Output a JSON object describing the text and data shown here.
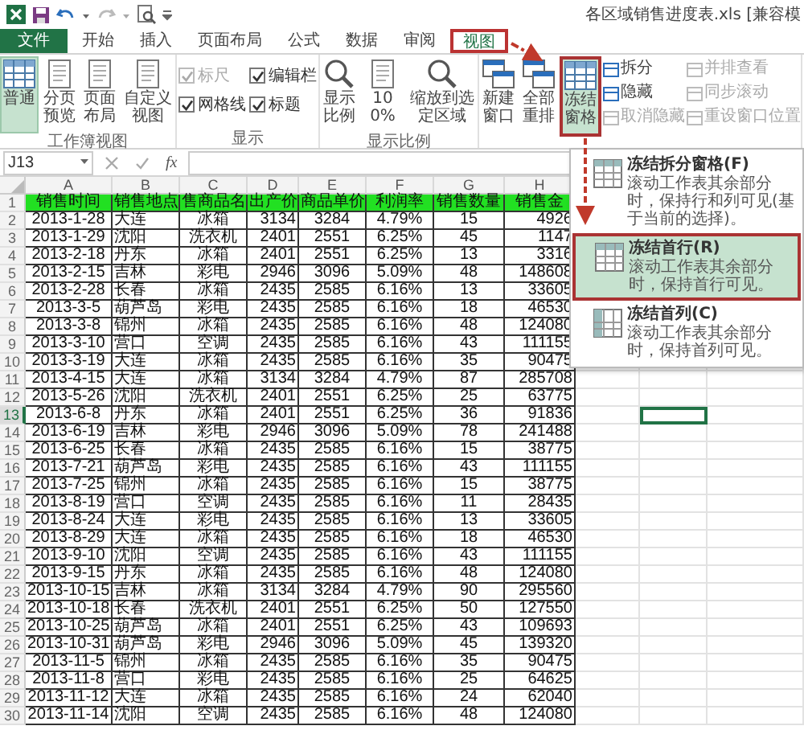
{
  "title_bar": {
    "title": "各区域销售进度表.xls  [兼容模"
  },
  "tabs": [
    {
      "label": "文件",
      "kind": "file",
      "selected": false,
      "highlighted": false
    },
    {
      "label": "开始",
      "kind": "tab",
      "selected": false,
      "highlighted": false
    },
    {
      "label": "插入",
      "kind": "tab",
      "selected": false,
      "highlighted": false
    },
    {
      "label": "页面布局",
      "kind": "tab",
      "selected": false,
      "highlighted": false
    },
    {
      "label": "公式",
      "kind": "tab",
      "selected": false,
      "highlighted": false
    },
    {
      "label": "数据",
      "kind": "tab",
      "selected": false,
      "highlighted": false
    },
    {
      "label": "审阅",
      "kind": "tab",
      "selected": false,
      "highlighted": false
    },
    {
      "label": "视图",
      "kind": "tab",
      "selected": true,
      "highlighted": true
    }
  ],
  "ribbon": {
    "groups": [
      {
        "label": "工作簿视图",
        "items": [
          {
            "kind": "large",
            "label": "普通",
            "selected": true,
            "highlighted": false
          },
          {
            "kind": "large",
            "label": "分页预览",
            "selected": false,
            "highlighted": false
          },
          {
            "kind": "large",
            "label": "页面布局",
            "selected": false,
            "highlighted": false
          },
          {
            "kind": "large",
            "label": "自定义视图",
            "selected": false,
            "highlighted": false
          }
        ]
      },
      {
        "label": "显示",
        "items": [
          {
            "kind": "check",
            "label": "标尺",
            "checked": true,
            "disabled": true
          },
          {
            "kind": "check",
            "label": "网格线",
            "checked": true,
            "disabled": false
          },
          {
            "kind": "check",
            "label": "编辑栏",
            "checked": true,
            "disabled": false
          },
          {
            "kind": "check",
            "label": "标题",
            "checked": true,
            "disabled": false
          }
        ]
      },
      {
        "label": "显示比例",
        "items": [
          {
            "kind": "large",
            "label": "显示比例",
            "selected": false,
            "highlighted": false
          },
          {
            "kind": "large",
            "label": "100%",
            "selected": false,
            "highlighted": false
          },
          {
            "kind": "large",
            "label": "缩放到选定区域",
            "selected": false,
            "highlighted": false
          }
        ]
      },
      {
        "items": [
          {
            "kind": "large",
            "label": "新建窗口",
            "selected": false,
            "highlighted": false
          },
          {
            "kind": "large",
            "label": "全部重排",
            "selected": false,
            "highlighted": false
          },
          {
            "kind": "large",
            "label": "冻结窗格",
            "selected": true,
            "highlighted": true
          },
          {
            "kind": "small",
            "label": "拆分",
            "disabled": false
          },
          {
            "kind": "small",
            "label": "隐藏",
            "disabled": false
          },
          {
            "kind": "small",
            "label": "取消隐藏",
            "disabled": true
          },
          {
            "kind": "small",
            "label": "并排查看",
            "disabled": true
          },
          {
            "kind": "small",
            "label": "同步滚动",
            "disabled": true
          },
          {
            "kind": "small",
            "label": "重设窗口位置",
            "disabled": true
          }
        ]
      }
    ]
  },
  "formula_bar": {
    "name_box": "J13",
    "function_label": "fx"
  },
  "freeze_menu": {
    "items": [
      {
        "title": "冻结拆分窗格(F)",
        "description": "滚动工作表其余部分时，保持行和列可见(基于当前的选择)。",
        "selected": false,
        "highlighted": false
      },
      {
        "title": "冻结首行(R)",
        "description": "滚动工作表其余部分时，保持首行可见。",
        "selected": true,
        "highlighted": true
      },
      {
        "title": "冻结首列(C)",
        "description": "滚动工作表其余部分时，保持首列可见。",
        "selected": false,
        "highlighted": false
      }
    ]
  },
  "sheet": {
    "columns": [
      "A",
      "B",
      "C",
      "D",
      "E",
      "F",
      "G",
      "H"
    ],
    "rows": [
      {
        "number": "1",
        "kind": "header",
        "selected": false,
        "cells": [
          "销售时间",
          "销售地点",
          "售商品名",
          "出产价",
          "商品单价",
          "利润率",
          "销售数量",
          "销售金"
        ]
      },
      {
        "number": "2",
        "kind": "data",
        "selected": false,
        "cells": [
          "2013-1-28",
          "大连",
          "冰箱",
          "3134",
          "3284",
          "4.79%",
          "15",
          "4926"
        ]
      },
      {
        "number": "3",
        "kind": "data",
        "selected": false,
        "cells": [
          "2013-1-29",
          "沈阳",
          "洗衣机",
          "2401",
          "2551",
          "6.25%",
          "45",
          "1147"
        ]
      },
      {
        "number": "4",
        "kind": "data",
        "selected": false,
        "cells": [
          "2013-2-18",
          "丹东",
          "冰箱",
          "2401",
          "2551",
          "6.25%",
          "13",
          "3316"
        ]
      },
      {
        "number": "5",
        "kind": "data",
        "selected": false,
        "cells": [
          "2013-2-15",
          "吉林",
          "彩电",
          "2946",
          "3096",
          "5.09%",
          "48",
          "148608"
        ]
      },
      {
        "number": "6",
        "kind": "data",
        "selected": false,
        "cells": [
          "2013-2-28",
          "长春",
          "冰箱",
          "2435",
          "2585",
          "6.16%",
          "13",
          "33605"
        ]
      },
      {
        "number": "7",
        "kind": "data",
        "selected": false,
        "cells": [
          "2013-3-5",
          "葫芦岛",
          "彩电",
          "2435",
          "2585",
          "6.16%",
          "18",
          "46530"
        ]
      },
      {
        "number": "8",
        "kind": "data",
        "selected": false,
        "cells": [
          "2013-3-8",
          "锦州",
          "冰箱",
          "2435",
          "2585",
          "6.16%",
          "48",
          "124080"
        ]
      },
      {
        "number": "9",
        "kind": "data",
        "selected": false,
        "cells": [
          "2013-3-10",
          "营口",
          "空调",
          "2435",
          "2585",
          "6.16%",
          "43",
          "111155"
        ]
      },
      {
        "number": "10",
        "kind": "data",
        "selected": false,
        "cells": [
          "2013-3-19",
          "大连",
          "冰箱",
          "2435",
          "2585",
          "6.16%",
          "35",
          "90475"
        ]
      },
      {
        "number": "11",
        "kind": "data",
        "selected": false,
        "cells": [
          "2013-4-15",
          "大连",
          "冰箱",
          "3134",
          "3284",
          "4.79%",
          "87",
          "285708"
        ]
      },
      {
        "number": "12",
        "kind": "data",
        "selected": false,
        "cells": [
          "2013-5-26",
          "沈阳",
          "洗衣机",
          "2401",
          "2551",
          "6.25%",
          "25",
          "63775"
        ]
      },
      {
        "number": "13",
        "kind": "data",
        "selected": true,
        "cells": [
          "2013-6-8",
          "丹东",
          "冰箱",
          "2401",
          "2551",
          "6.25%",
          "36",
          "91836"
        ]
      },
      {
        "number": "14",
        "kind": "data",
        "selected": false,
        "cells": [
          "2013-6-19",
          "吉林",
          "彩电",
          "2946",
          "3096",
          "5.09%",
          "78",
          "241488"
        ]
      },
      {
        "number": "15",
        "kind": "data",
        "selected": false,
        "cells": [
          "2013-6-25",
          "长春",
          "冰箱",
          "2435",
          "2585",
          "6.16%",
          "15",
          "38775"
        ]
      },
      {
        "number": "16",
        "kind": "data",
        "selected": false,
        "cells": [
          "2013-7-21",
          "葫芦岛",
          "彩电",
          "2435",
          "2585",
          "6.16%",
          "43",
          "111155"
        ]
      },
      {
        "number": "17",
        "kind": "data",
        "selected": false,
        "cells": [
          "2013-7-25",
          "锦州",
          "冰箱",
          "2435",
          "2585",
          "6.16%",
          "15",
          "38775"
        ]
      },
      {
        "number": "18",
        "kind": "data",
        "selected": false,
        "cells": [
          "2013-8-19",
          "营口",
          "空调",
          "2435",
          "2585",
          "6.16%",
          "11",
          "28435"
        ]
      },
      {
        "number": "19",
        "kind": "data",
        "selected": false,
        "cells": [
          "2013-8-24",
          "大连",
          "彩电",
          "2435",
          "2585",
          "6.16%",
          "13",
          "33605"
        ]
      },
      {
        "number": "20",
        "kind": "data",
        "selected": false,
        "cells": [
          "2013-8-29",
          "大连",
          "冰箱",
          "2435",
          "2585",
          "6.16%",
          "18",
          "46530"
        ]
      },
      {
        "number": "21",
        "kind": "data",
        "selected": false,
        "cells": [
          "2013-9-10",
          "沈阳",
          "空调",
          "2435",
          "2585",
          "6.16%",
          "43",
          "111155"
        ]
      },
      {
        "number": "22",
        "kind": "data",
        "selected": false,
        "cells": [
          "2013-9-15",
          "丹东",
          "冰箱",
          "2435",
          "2585",
          "6.16%",
          "48",
          "124080"
        ]
      },
      {
        "number": "23",
        "kind": "data",
        "selected": false,
        "cells": [
          "2013-10-15",
          "吉林",
          "冰箱",
          "3134",
          "3284",
          "4.79%",
          "90",
          "295560"
        ]
      },
      {
        "number": "24",
        "kind": "data",
        "selected": false,
        "cells": [
          "2013-10-18",
          "长春",
          "洗衣机",
          "2401",
          "2551",
          "6.25%",
          "50",
          "127550"
        ]
      },
      {
        "number": "25",
        "kind": "data",
        "selected": false,
        "cells": [
          "2013-10-25",
          "葫芦岛",
          "冰箱",
          "2401",
          "2551",
          "6.25%",
          "43",
          "109693"
        ]
      },
      {
        "number": "26",
        "kind": "data",
        "selected": false,
        "cells": [
          "2013-10-31",
          "葫芦岛",
          "彩电",
          "2946",
          "3096",
          "5.09%",
          "45",
          "139320"
        ]
      },
      {
        "number": "27",
        "kind": "data",
        "selected": false,
        "cells": [
          "2013-11-5",
          "锦州",
          "冰箱",
          "2435",
          "2585",
          "6.16%",
          "35",
          "90475"
        ]
      },
      {
        "number": "28",
        "kind": "data",
        "selected": false,
        "cells": [
          "2013-11-8",
          "营口",
          "彩电",
          "2435",
          "2585",
          "6.16%",
          "25",
          "64625"
        ]
      },
      {
        "number": "29",
        "kind": "data",
        "selected": false,
        "cells": [
          "2013-11-12",
          "大连",
          "冰箱",
          "2435",
          "2585",
          "6.16%",
          "24",
          "62040"
        ]
      },
      {
        "number": "30",
        "kind": "data",
        "selected": false,
        "cells": [
          "2013-11-14",
          "沈阳",
          "空调",
          "2435",
          "2585",
          "6.16%",
          "48",
          "124080"
        ]
      }
    ]
  }
}
